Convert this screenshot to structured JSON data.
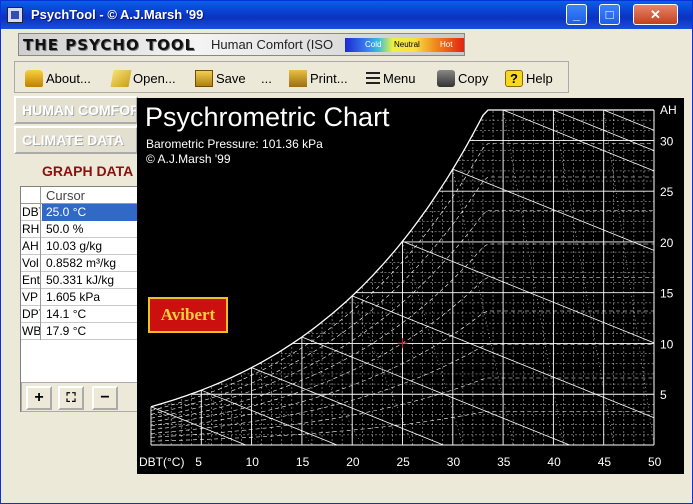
{
  "window": {
    "title": "PsychTool - © A.J.Marsh '99"
  },
  "banner": {
    "brand": "THE PSYCHO TOOL",
    "subtitle": "Human Comfort (ISO",
    "scale": {
      "cold": "Cold",
      "neutral": "Neutral",
      "hot": "Hot"
    }
  },
  "toolbar": {
    "about": "About...",
    "open": "Open...",
    "save": "Save",
    "ellipsis": "...",
    "print": "Print...",
    "menu": "Menu",
    "copy": "Copy",
    "help": "Help"
  },
  "sidebar": {
    "human_comfort": "HUMAN COMFORT",
    "climate_data": "CLIMATE DATA",
    "graph_data": "GRAPH DATA"
  },
  "grid": {
    "header": "Cursor",
    "rows": [
      {
        "key": "DBT",
        "value": "25.0 °C"
      },
      {
        "key": "RH",
        "value": "50.0 %"
      },
      {
        "key": "AH",
        "value": "10.03 g/kg"
      },
      {
        "key": "Vol",
        "value": "0.8582 m³/kg"
      },
      {
        "key": "Enth",
        "value": "50.331 kJ/kg"
      },
      {
        "key": "VP",
        "value": "1.605 kPa"
      },
      {
        "key": "DPT",
        "value": "14.1 °C"
      },
      {
        "key": "WBT",
        "value": "17.9 °C"
      }
    ]
  },
  "bottom_buttons": {
    "plus": "+",
    "fit": "⛶",
    "minus": "−"
  },
  "chart": {
    "title": "Psychrometric Chart",
    "pressure": "Barometric Pressure: 101.36 kPa",
    "copyright": "© A.J.Marsh '99",
    "stamp": "Avibert"
  },
  "chart_data": {
    "type": "line",
    "title": "Psychrometric Chart",
    "xlabel": "DBT(°C)",
    "ylabel": "AH",
    "x_ticks": [
      "5",
      "10",
      "15",
      "20",
      "25",
      "30",
      "35",
      "40",
      "45",
      "50"
    ],
    "y_ticks": [
      "5",
      "10",
      "15",
      "20",
      "25",
      "30"
    ],
    "xlim": [
      0,
      50
    ],
    "ylim": [
      0,
      33
    ],
    "cursor": {
      "dbt": 25.0,
      "ah": 10.03
    },
    "series": [
      {
        "name": "",
        "x": [
          0,
          5,
          10,
          15,
          20,
          25,
          30,
          35,
          40,
          45,
          50
        ],
        "y": [
          3.8,
          5.4,
          7.6,
          10.6,
          14.7,
          20.0,
          27.2,
          33,
          33,
          33,
          33
        ]
      }
    ],
    "colors": {
      "background": "#000000",
      "grid": "#ffffff",
      "cursor": "#d02020"
    }
  }
}
